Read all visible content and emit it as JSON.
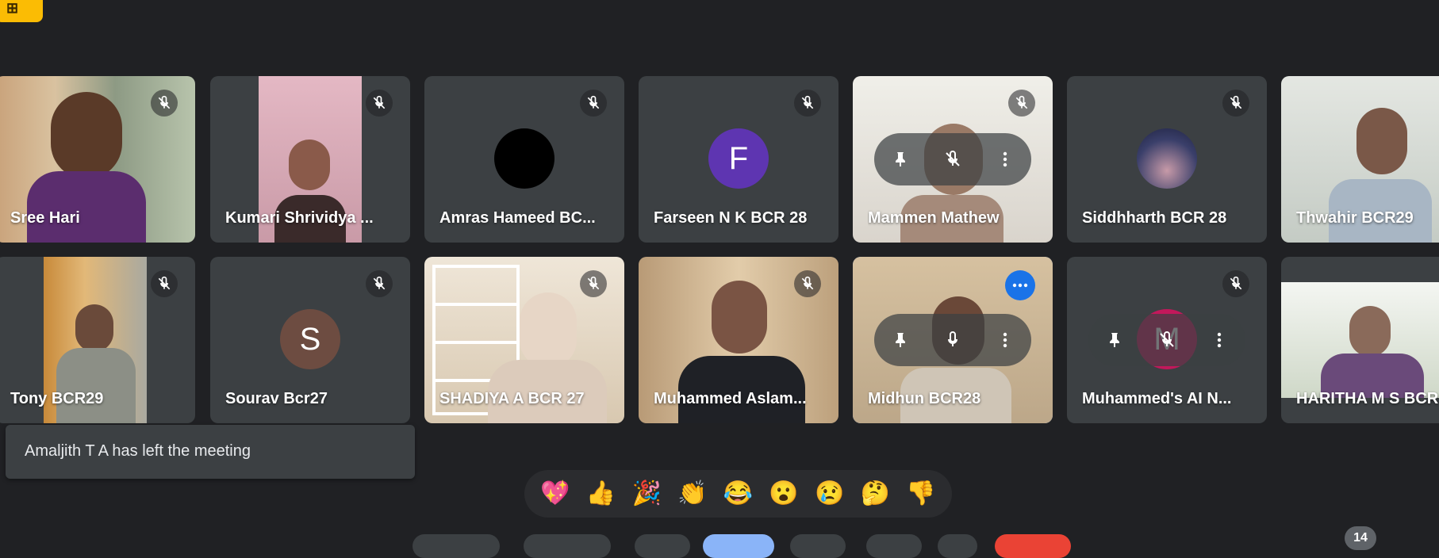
{
  "colors": {
    "background": "#202124",
    "tile": "#3c4043",
    "accent": "#8ab4f8",
    "badge": "#fbbc04"
  },
  "corner_badge": {
    "icon": "layout-icon"
  },
  "participants": [
    {
      "name": "Sree Hari"
    },
    {
      "name": "Kumari Shrividya ..."
    },
    {
      "name": "Amras Hameed BC..."
    },
    {
      "name": "Farseen N K BCR 28",
      "initial": "F"
    },
    {
      "name": "Mammen Mathew"
    },
    {
      "name": "Siddhharth BCR 28"
    },
    {
      "name": "Thwahir BCR29"
    },
    {
      "name": "Tony BCR29"
    },
    {
      "name": "Sourav Bcr27",
      "initial": "S"
    },
    {
      "name": "SHADIYA A BCR 27"
    },
    {
      "name": "Muhammed Aslam..."
    },
    {
      "name": "Midhun BCR28"
    },
    {
      "name": "Muhammed's AI N...",
      "initial": "M"
    },
    {
      "name": "HARITHA M S BCR"
    }
  ],
  "toast": {
    "message": "Amaljith T A has left the meeting"
  },
  "reactions": [
    "💖",
    "👍",
    "🎉",
    "👏",
    "😂",
    "😮",
    "😢",
    "🤔",
    "👎"
  ],
  "participant_count": "14"
}
